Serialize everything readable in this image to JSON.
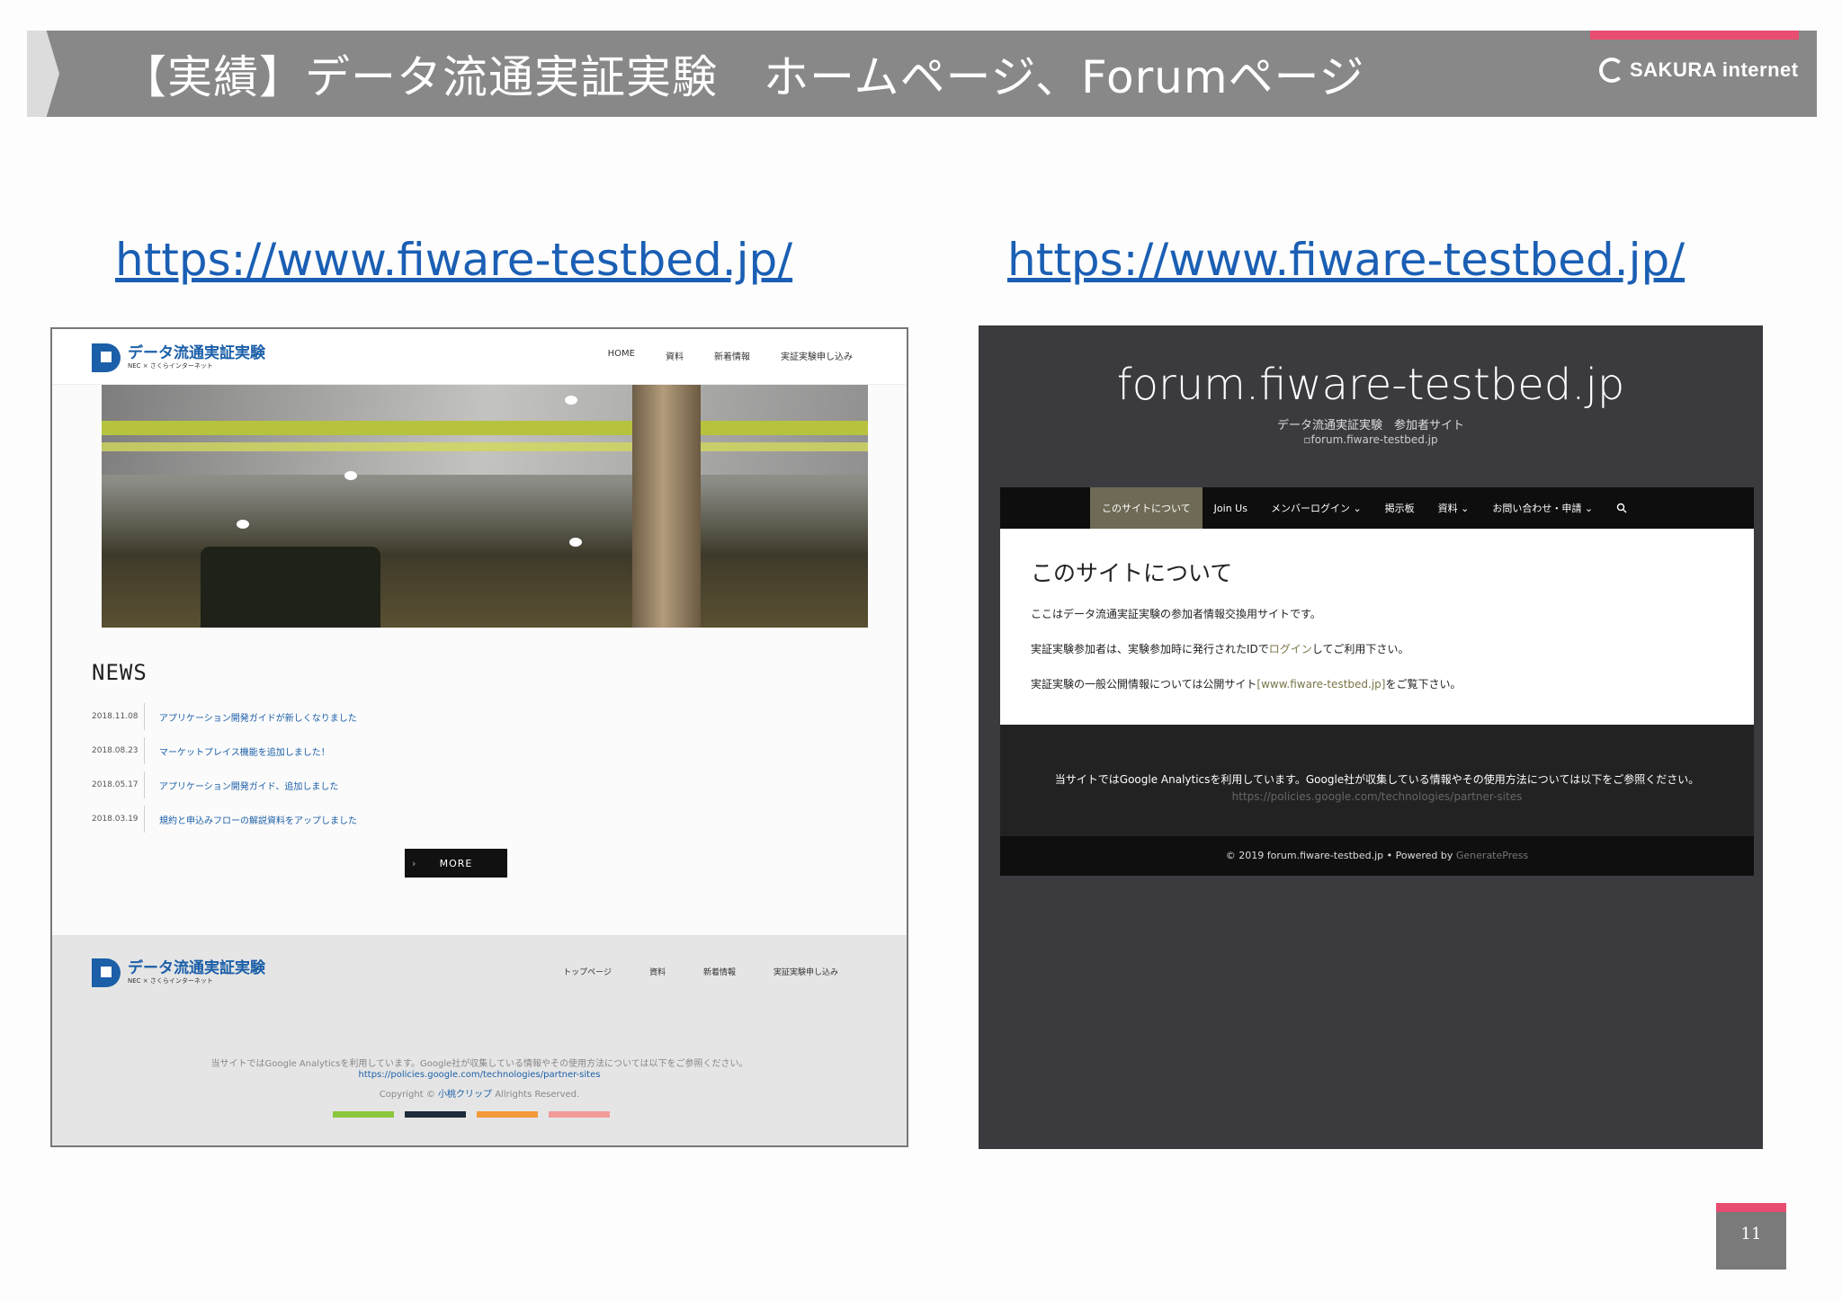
{
  "slide": {
    "title": "【実績】データ流通実証実験　ホームページ、Forumページ",
    "logo_text": "SAKURA internet",
    "page_number": "11",
    "url_left": "https://www.fiware-testbed.jp/",
    "url_right": "https://www.fiware-testbed.jp/",
    "accent_color": "#e84c70",
    "bar_color": "#888888"
  },
  "homepage": {
    "logo_title": "データ流通実証実験",
    "logo_sub": "NEC × さくらインターネット",
    "nav": [
      "HOME",
      "資料",
      "新着情報",
      "実証実験申し込み"
    ],
    "news_title": "NEWS",
    "news": [
      {
        "date": "2018.11.08",
        "text": "アプリケーション開発ガイドが新しくなりました"
      },
      {
        "date": "2018.08.23",
        "text": "マーケットプレイス機能を追加しました！"
      },
      {
        "date": "2018.05.17",
        "text": "アプリケーション開発ガイド、追加しました"
      },
      {
        "date": "2018.03.19",
        "text": "規約と申込みフローの解説資料をアップしました"
      }
    ],
    "more_label": "MORE",
    "footer_nav": [
      "トップページ",
      "資料",
      "新着情報",
      "実証実験申し込み"
    ],
    "footer_text1": "当サイトではGoogle Analyticsを利用しています。Google社が収集している情報やその使用方法については以下をご参照ください。",
    "footer_link": "https://policies.google.com/technologies/partner-sites",
    "copyright_prefix": "Copyright ©",
    "copyright_owner": "小桃クリップ",
    "copyright_suffix": "Allrights Reserved."
  },
  "forum": {
    "site_title": "forum.fiware-testbed.jp",
    "tagline": "データ流通実証実験　参加者サイト",
    "image_alt": "forum.fiware-testbed.jp",
    "nav": [
      "このサイトについて",
      "Join Us",
      "メンバーログイン ⌄",
      "掲示板",
      "資料 ⌄",
      "お問い合わせ・申請 ⌄"
    ],
    "search_icon": "search-icon",
    "page_heading": "このサイトについて",
    "p1": "ここはデータ流通実証実験の参加者情報交換用サイトです。",
    "p2_a": "実証実験参加者は、実験参加時に発行されたIDで",
    "p2_link": "ログイン",
    "p2_b": "してご利用下さい。",
    "p3_a": "実証実験の一般公開情報については公開サイト",
    "p3_link": "[www.fiware-testbed.jp]",
    "p3_b": "をご覧下さい。",
    "footer_text": "当サイトではGoogle Analyticsを利用しています。Google社が収集している情報やその使用方法については以下をご参照ください。",
    "footer_link": "https://policies.google.com/technologies/partner-sites",
    "credit_a": "© 2019 forum.fiware-testbed.jp • Powered by",
    "credit_link": "GeneratePress"
  }
}
